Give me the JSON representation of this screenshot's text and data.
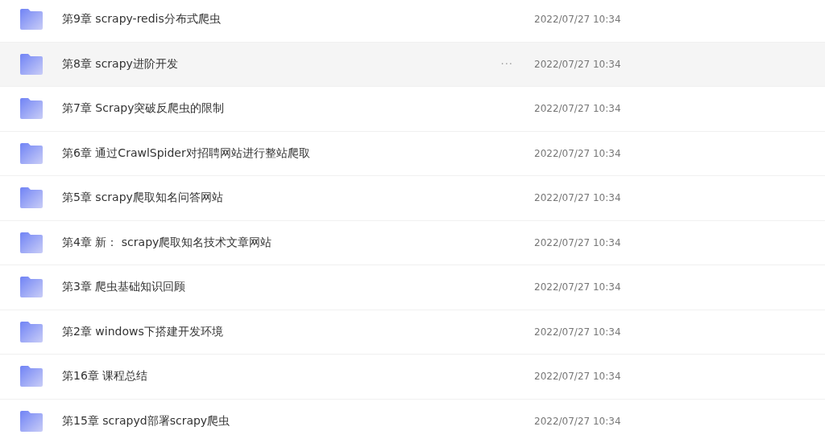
{
  "files": [
    {
      "name": "第9章 scrapy-redis分布式爬虫",
      "date": "2022/07/27 10:34"
    },
    {
      "name": "第8章 scrapy进阶开发",
      "date": "2022/07/27 10:34",
      "hovered": true,
      "more": "···"
    },
    {
      "name": "第7章 Scrapy突破反爬虫的限制",
      "date": "2022/07/27 10:34"
    },
    {
      "name": "第6章 通过CrawlSpider对招聘网站进行整站爬取",
      "date": "2022/07/27 10:34"
    },
    {
      "name": "第5章 scrapy爬取知名问答网站",
      "date": "2022/07/27 10:34"
    },
    {
      "name": "第4章 新： scrapy爬取知名技术文章网站",
      "date": "2022/07/27 10:34"
    },
    {
      "name": "第3章 爬虫基础知识回顾",
      "date": "2022/07/27 10:34"
    },
    {
      "name": "第2章 windows下搭建开发环境",
      "date": "2022/07/27 10:34"
    },
    {
      "name": "第16章 课程总结",
      "date": "2022/07/27 10:34"
    },
    {
      "name": "第15章 scrapyd部署scrapy爬虫",
      "date": "2022/07/27 10:34"
    }
  ]
}
